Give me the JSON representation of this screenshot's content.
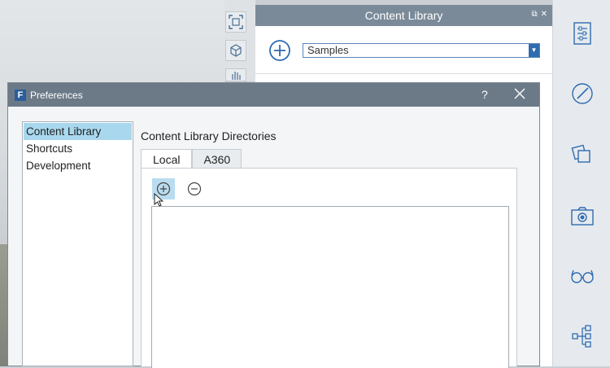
{
  "content_library": {
    "title": "Content Library",
    "selected_library": "Samples",
    "header_icons": [
      "restore-icon",
      "close-icon"
    ]
  },
  "viewport_tools": [
    "frame-icon",
    "cube-icon",
    "hand-icon"
  ],
  "right_toolbar": [
    "sliders-icon",
    "brush-icon",
    "layers-icon",
    "camera-icon",
    "glasses-icon",
    "hierarchy-icon"
  ],
  "preferences": {
    "title": "Preferences",
    "help": "?",
    "categories": [
      "Content Library",
      "Shortcuts",
      "Development"
    ],
    "selected_category": "Content Library",
    "section_title": "Content Library Directories",
    "tabs": [
      "Local",
      "A360"
    ],
    "active_tab": "Local",
    "directories": []
  },
  "colors": {
    "accent": "#2f6bb0",
    "title_bar": "#6c7a88",
    "selection": "#a9d8ee"
  }
}
